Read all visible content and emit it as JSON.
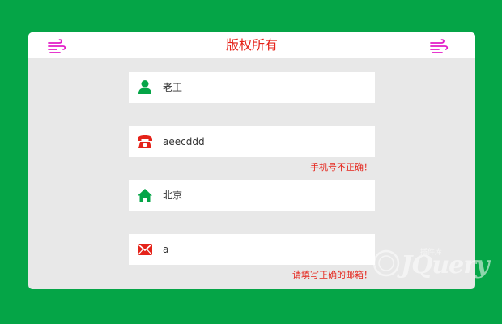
{
  "header": {
    "title": "版权所有",
    "left_icon": "wind-icon",
    "right_icon": "wind-icon",
    "title_color": "#e5231a",
    "icon_color": "#e21cc7"
  },
  "form": {
    "name": {
      "value": "老王",
      "icon": "user-icon",
      "icon_color": "#05a547"
    },
    "phone": {
      "value": "aeecddd",
      "icon": "phone-icon",
      "icon_color": "#e5231a",
      "error": "手机号不正确！"
    },
    "address": {
      "value": "北京",
      "icon": "home-icon",
      "icon_color": "#05a547"
    },
    "email": {
      "value": "a",
      "icon": "mail-icon",
      "icon_color": "#e5231a",
      "error": "请填写正确的邮箱！"
    }
  },
  "watermark": {
    "text": "JQuery",
    "subtext": "插件库"
  },
  "colors": {
    "background": "#05a547",
    "card": "#e8e8e8",
    "error": "#e5231a"
  }
}
